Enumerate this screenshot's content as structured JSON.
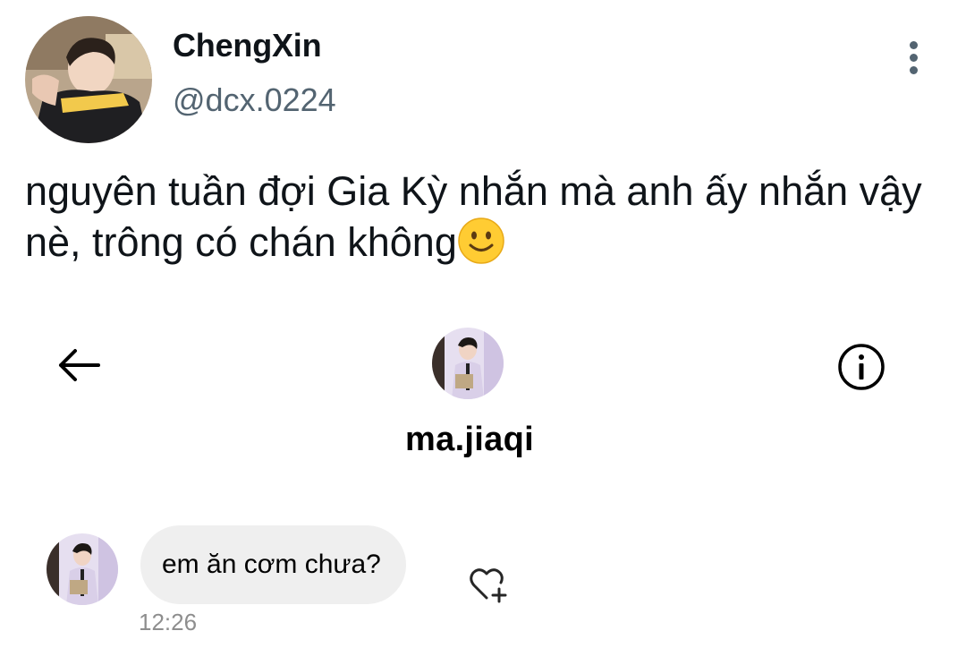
{
  "tweet": {
    "author": {
      "display_name": "ChengXin",
      "handle": "@dcx.0224",
      "avatar_icon": "profile-photo"
    },
    "text": "nguyên tuần đợi Gia Kỳ nhắn mà anh ấy nhắn vậy nè, trông có chán không",
    "emoji": "slightly-smiling-face-emoji",
    "more_icon": "more-vertical-icon"
  },
  "dm": {
    "back_icon": "back-arrow-icon",
    "info_icon": "info-icon",
    "username": "ma.jiaqi",
    "messages": [
      {
        "text": "em ăn cơm chưa?",
        "time": "12:26",
        "reaction_icon": "heart-plus-icon"
      }
    ]
  },
  "colors": {
    "text_primary": "#0f1419",
    "text_secondary": "#536471",
    "bubble_bg": "#efefef",
    "timestamp": "#8e8e8e",
    "emoji_yellow": "#ffcc33"
  }
}
